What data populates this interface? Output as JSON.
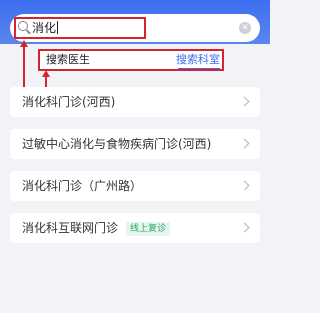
{
  "search": {
    "query": "消化"
  },
  "tabs": [
    {
      "label": "搜索医生",
      "active": false
    },
    {
      "label": "搜索科室",
      "active": true
    }
  ],
  "results": [
    {
      "label": "消化科门诊(河西)",
      "badge": ""
    },
    {
      "label": "过敏中心消化与食物疾病门诊(河西)",
      "badge": ""
    },
    {
      "label": "消化科门诊（广州路）",
      "badge": ""
    },
    {
      "label": "消化科互联网门诊",
      "badge": "线上复诊"
    }
  ],
  "colors": {
    "accent": "#3c6ff0",
    "annotation": "#d6242f",
    "badge_text": "#2ba56a"
  }
}
